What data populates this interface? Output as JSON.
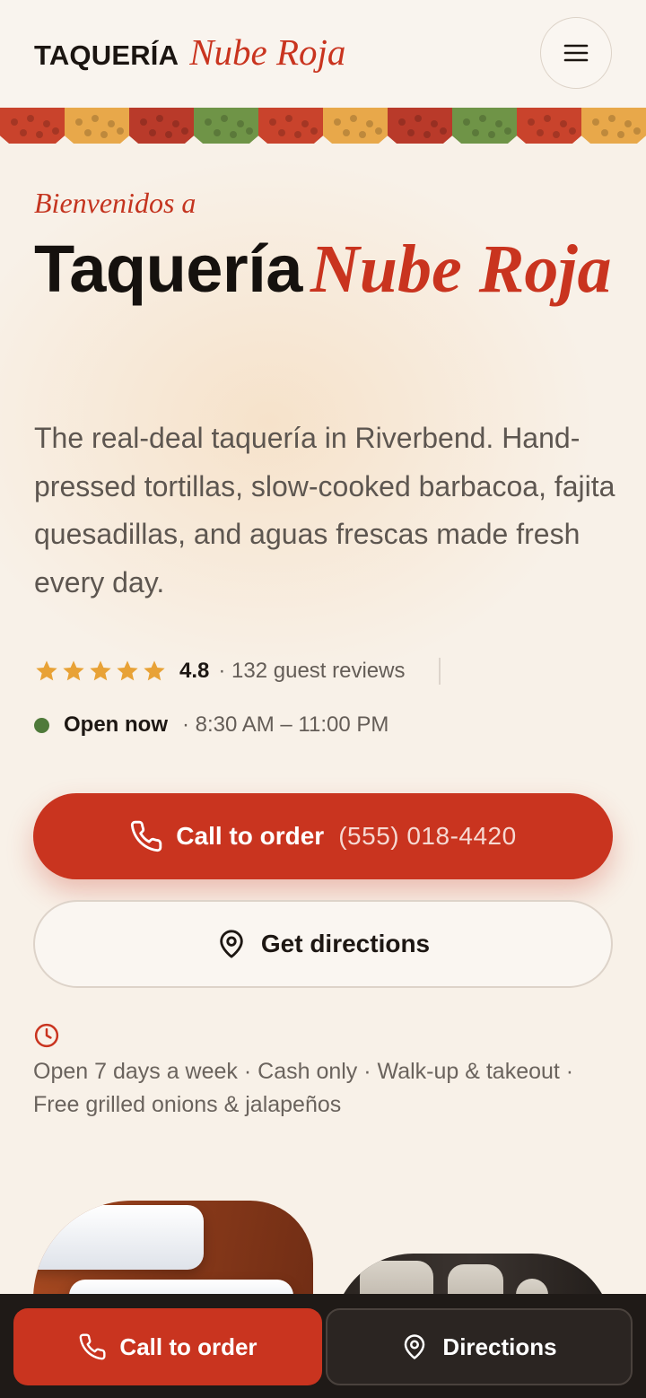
{
  "header": {
    "brand_sans": "TAQUERÍA",
    "brand_script": "Nube Roja",
    "menu_icon": "hamburger-menu-icon"
  },
  "banner": {
    "colors": [
      "#c9432c",
      "#e8a84a",
      "#b93a2a",
      "#6f9447",
      "#c9432c",
      "#e8a84a",
      "#b93a2a",
      "#6f9447",
      "#c9432c",
      "#e8a84a"
    ]
  },
  "hero": {
    "kicker": "Bienvenidos a",
    "title_sans": "Taquería",
    "title_script": "Nube Roja",
    "description": "The real-deal taquería in Riverbend. Hand-pressed tortillas, slow-cooked barbacoa, fajita quesadillas, and aguas frescas made fresh every day."
  },
  "rating": {
    "stars": 5,
    "value": "4.8",
    "count_text": "· 132 guest reviews"
  },
  "status": {
    "label": "Open now",
    "hours": "· 8:30 AM – 11:00 PM"
  },
  "cta": {
    "call_label": "Call to order",
    "call_number": "(555) 018-4420",
    "directions_label": "Get directions"
  },
  "info": {
    "text": "Open 7 days a week · Cash only · Walk-up & takeout · Free grilled onions & jalapeños"
  },
  "bottom_bar": {
    "call_label": "Call to order",
    "directions_label": "Directions"
  },
  "colors": {
    "accent": "#c9341f",
    "background": "#f8f1e8",
    "star": "#e8a236",
    "open_green": "#4f7a3a",
    "dark_bar": "#1f1a17"
  }
}
